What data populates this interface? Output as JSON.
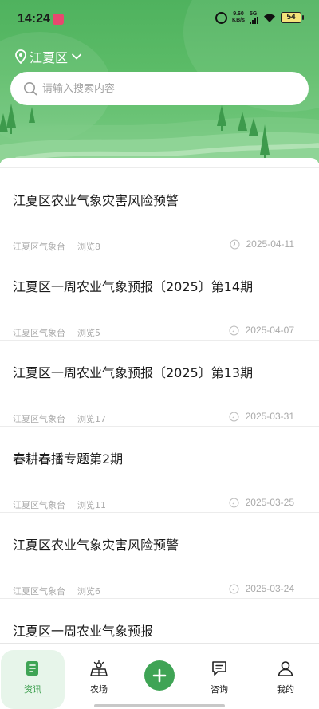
{
  "status_bar": {
    "time": "14:24",
    "net_speed_value": "9.60",
    "net_speed_unit": "KB/s",
    "signal": "5G",
    "battery": "54"
  },
  "header": {
    "location": "江夏区",
    "search_placeholder": "请输入搜索内容"
  },
  "articles": [
    {
      "title": "江夏区农业气象灾害风险预警",
      "source": "江夏区气象台",
      "views": "浏览8",
      "date": "2025-04-11"
    },
    {
      "title": "江夏区一周农业气象预报〔2025〕第14期",
      "source": "江夏区气象台",
      "views": "浏览5",
      "date": "2025-04-07"
    },
    {
      "title": "江夏区一周农业气象预报〔2025〕第13期",
      "source": "江夏区气象台",
      "views": "浏览17",
      "date": "2025-03-31"
    },
    {
      "title": "春耕春播专题第2期",
      "source": "江夏区气象台",
      "views": "浏览11",
      "date": "2025-03-25"
    },
    {
      "title": "江夏区农业气象灾害风险预警",
      "source": "江夏区气象台",
      "views": "浏览6",
      "date": "2025-03-24"
    },
    {
      "title": "江夏区一周农业气象预报",
      "source": "",
      "views": "",
      "date": ""
    }
  ],
  "tabbar": {
    "news": "资讯",
    "farm": "农场",
    "consult": "咨询",
    "mine": "我的"
  },
  "colors": {
    "brand_green": "#4fb25e",
    "accent_green": "#3fa455",
    "active_tab_bg": "#e7f5ea"
  }
}
